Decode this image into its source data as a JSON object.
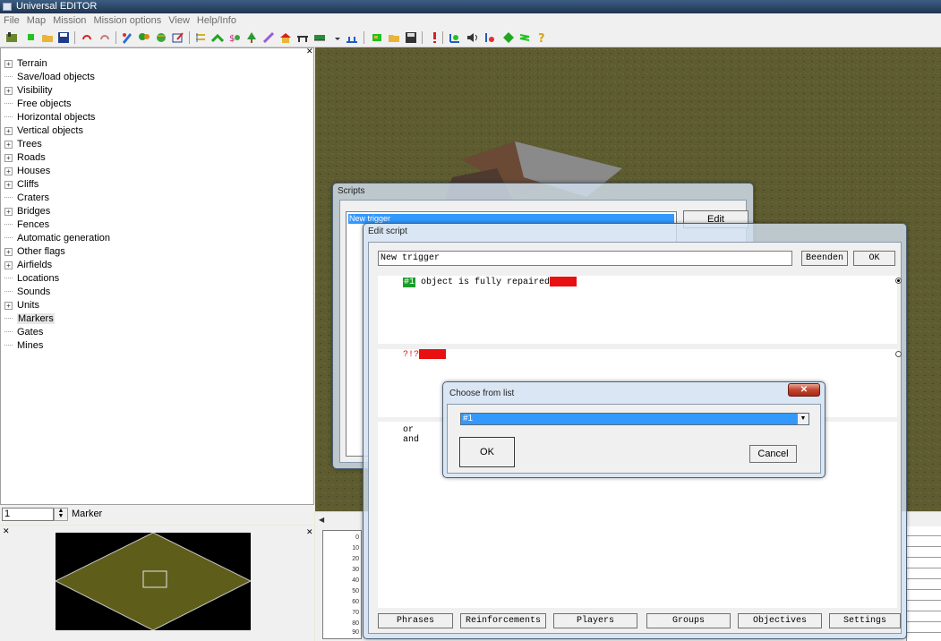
{
  "window": {
    "title": "Universal EDITOR"
  },
  "menu": [
    "File",
    "Map",
    "Mission",
    "Mission options",
    "View",
    "Help/Info"
  ],
  "tree": {
    "items": [
      {
        "label": "Terrain",
        "expandable": true
      },
      {
        "label": "Save/load objects",
        "expandable": false
      },
      {
        "label": "Visibility",
        "expandable": true
      },
      {
        "label": "Free objects",
        "expandable": false
      },
      {
        "label": "Horizontal objects",
        "expandable": false
      },
      {
        "label": "Vertical objects",
        "expandable": true
      },
      {
        "label": "Trees",
        "expandable": true
      },
      {
        "label": "Roads",
        "expandable": true
      },
      {
        "label": "Houses",
        "expandable": true
      },
      {
        "label": "Cliffs",
        "expandable": true
      },
      {
        "label": "Craters",
        "expandable": false
      },
      {
        "label": "Bridges",
        "expandable": true
      },
      {
        "label": "Fences",
        "expandable": false
      },
      {
        "label": "Automatic generation",
        "expandable": false
      },
      {
        "label": "Other flags",
        "expandable": true
      },
      {
        "label": "Airfields",
        "expandable": true
      },
      {
        "label": "Locations",
        "expandable": false
      },
      {
        "label": "Sounds",
        "expandable": false
      },
      {
        "label": "Units",
        "expandable": true
      },
      {
        "label": "Markers",
        "expandable": false,
        "selected": true
      },
      {
        "label": "Gates",
        "expandable": false
      },
      {
        "label": "Mines",
        "expandable": false
      }
    ]
  },
  "spinner": {
    "value": "1",
    "label": "Marker"
  },
  "grid": {
    "numbers": [
      "0",
      "10",
      "20",
      "30",
      "40",
      "50",
      "60",
      "70",
      "80",
      "90"
    ]
  },
  "scripts_dialog": {
    "title": "Scripts",
    "selected_item": "New trigger",
    "edit_button": "Edit"
  },
  "edit_script": {
    "title": "Edit script",
    "name": "New trigger",
    "exit_button": "Beenden",
    "ok_button": "OK",
    "condition_number": "#1",
    "condition_text": "object is fully repaired",
    "action_text": "?!?",
    "logic_or": "or",
    "logic_and": "and",
    "tabs": [
      "Phrases",
      "Reinforcements",
      "Players",
      "Groups",
      "Objectives",
      "Settings"
    ]
  },
  "choose_dialog": {
    "title": "Choose from list",
    "selected": "#1",
    "ok": "OK",
    "cancel": "Cancel"
  },
  "colors": {
    "titlebar": "#1f3550",
    "selection": "#3399ff",
    "green": "#1a9c2a",
    "red": "#e81010",
    "terrain": "#5d5b30",
    "minimap_land": "#5e5e1a"
  },
  "icons": [
    "open-map-icon",
    "new-icon",
    "open-folder-icon",
    "save-icon",
    "undo-icon",
    "redo-icon",
    "paint-icon",
    "tree-icon",
    "house-icon",
    "edit-icon",
    "flag-icon",
    "road-icon",
    "unit-icon",
    "bridge-icon",
    "sound-icon",
    "help-icon"
  ]
}
